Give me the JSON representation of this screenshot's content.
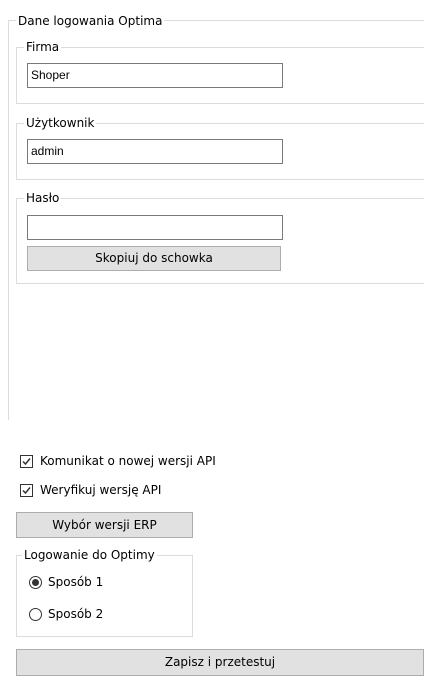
{
  "login_group": {
    "legend": "Dane logowania Optima",
    "firma": {
      "legend": "Firma",
      "value": "Shoper"
    },
    "uzytkownik": {
      "legend": "Użytkownik",
      "value": "admin"
    },
    "haslo": {
      "legend": "Hasło",
      "value": "",
      "copy_button": "Skopiuj do schowka"
    }
  },
  "options": {
    "api_notice": {
      "label": "Komunikat o nowej wersji API",
      "checked": true
    },
    "verify_api": {
      "label": "Weryfikuj wersję API",
      "checked": true
    },
    "erp_button": "Wybór wersji ERP"
  },
  "login_method": {
    "legend": "Logowanie do Optimy",
    "options": [
      {
        "label": "Sposób 1",
        "checked": true
      },
      {
        "label": "Sposób 2",
        "checked": false
      }
    ]
  },
  "save_button": "Zapisz i przetestuj"
}
